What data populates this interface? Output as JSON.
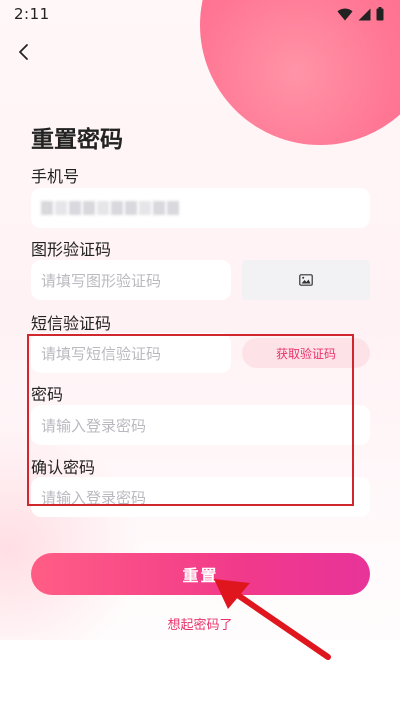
{
  "status_bar": {
    "time": "2:11"
  },
  "page": {
    "title": "重置密码"
  },
  "form": {
    "phone_label": "手机号",
    "captcha_label": "图形验证码",
    "captcha_placeholder": "请填写图形验证码",
    "sms_label": "短信验证码",
    "sms_placeholder": "请填写短信验证码",
    "sms_button": "获取验证码",
    "password_label": "密码",
    "password_placeholder": "请输入登录密码",
    "confirm_label": "确认密码",
    "confirm_placeholder": "请输入登录密码"
  },
  "actions": {
    "reset_button": "重置",
    "remember_link": "想起密码了"
  },
  "colors": {
    "accent": "#e8336a",
    "button_gradient_start": "#ff5d85",
    "button_gradient_end": "#e83399",
    "highlight_box": "#d0262e",
    "annotation_arrow": "#e0161f"
  },
  "icons": {
    "back": "chevron-left-icon",
    "captcha": "image-icon",
    "wifi": "wifi-icon",
    "signal": "signal-icon",
    "battery": "battery-icon"
  }
}
